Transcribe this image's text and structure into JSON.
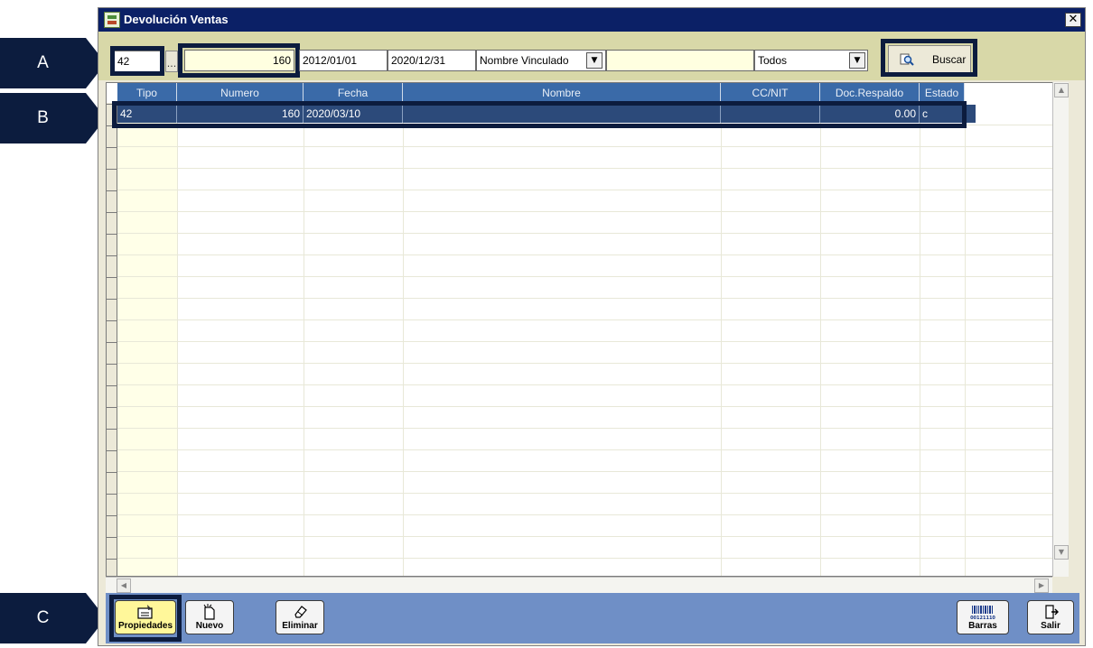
{
  "callouts": {
    "a": "A",
    "b": "B",
    "c": "C"
  },
  "window": {
    "title": "Devolución Ventas",
    "close_glyph": "✕"
  },
  "filters": {
    "tipo": "42",
    "dots": "...",
    "numero": "160",
    "fecha_desde": "2012/01/01",
    "fecha_hasta": "2020/12/31",
    "criterio": "Nombre Vinculado",
    "texto": "",
    "estado": "Todos",
    "buscar_label": "Buscar"
  },
  "grid": {
    "columns": [
      "Tipo",
      "Numero",
      "Fecha",
      "Nombre",
      "CC/NIT",
      "Doc.Respaldo",
      "Estado"
    ],
    "rows": [
      {
        "tipo": "42",
        "numero": "160",
        "fecha": "2020/03/10",
        "nombre": "",
        "ccnit": "",
        "doc_respaldo": "0.00",
        "estado": "c"
      }
    ]
  },
  "buttons": {
    "propiedades": "Propiedades",
    "nuevo": "Nuevo",
    "eliminar": "Eliminar",
    "barras": "Barras",
    "barras_code": "00121110",
    "salir": "Salir"
  },
  "colors": {
    "titlebar": "#0b2066",
    "filterbar": "#d8d8a8",
    "header": "#3a6aa8",
    "selected_row": "#2c4a7a",
    "bottombar": "#6f8fc6",
    "callout": "#0c1c3e"
  }
}
